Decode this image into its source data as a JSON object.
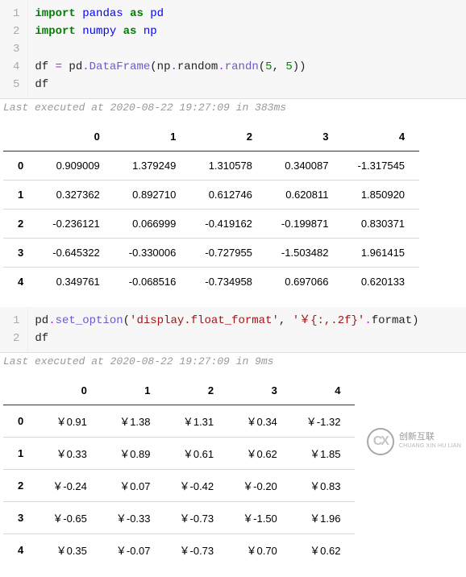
{
  "cells": [
    {
      "lines": [
        "1",
        "2",
        "3",
        "4",
        "5"
      ],
      "code_html": "<span class='kw'>import</span> <span class='pkg'>pandas</span> <span class='kw'>as</span> <span class='pkg'>pd</span>\n<span class='kw'>import</span> <span class='pkg'>numpy</span> <span class='kw'>as</span> <span class='pkg'>np</span>\n\n<span class='plain'>df </span><span class='op'>=</span><span class='plain'> pd</span><span class='op'>.</span><span class='fn'>DataFrame</span><span class='plain'>(np</span><span class='op'>.</span><span class='plain'>random</span><span class='op'>.</span><span class='fn'>randn</span><span class='plain'>(</span><span class='num'>5</span><span class='plain'>, </span><span class='num'>5</span><span class='plain'>))</span>\n<span class='plain'>df</span>",
      "status": "Last executed at 2020-08-22 19:27:09 in 383ms",
      "table": {
        "cols": [
          "0",
          "1",
          "2",
          "3",
          "4"
        ],
        "rows": [
          {
            "h": "0",
            "c": [
              "0.909009",
              "1.379249",
              "1.310578",
              "0.340087",
              "-1.317545"
            ]
          },
          {
            "h": "1",
            "c": [
              "0.327362",
              "0.892710",
              "0.612746",
              "0.620811",
              "1.850920"
            ]
          },
          {
            "h": "2",
            "c": [
              "-0.236121",
              "0.066999",
              "-0.419162",
              "-0.199871",
              "0.830371"
            ]
          },
          {
            "h": "3",
            "c": [
              "-0.645322",
              "-0.330006",
              "-0.727955",
              "-1.503482",
              "1.961415"
            ]
          },
          {
            "h": "4",
            "c": [
              "0.349761",
              "-0.068516",
              "-0.734958",
              "0.697066",
              "0.620133"
            ]
          }
        ]
      }
    },
    {
      "lines": [
        "1",
        "2"
      ],
      "code_html": "<span class='plain'>pd</span><span class='op'>.</span><span class='fn'>set_option</span><span class='plain'>(</span><span class='str'>'display.float_format'</span><span class='plain'>, </span><span class='str'>'￥{:,.2f}'</span><span class='op'>.</span><span class='plain'>format)</span>\n<span class='plain'>df</span>",
      "status": "Last executed at 2020-08-22 19:27:09 in 9ms",
      "table": {
        "cols": [
          "0",
          "1",
          "2",
          "3",
          "4"
        ],
        "rows": [
          {
            "h": "0",
            "c": [
              "￥0.91",
              "￥1.38",
              "￥1.31",
              "￥0.34",
              "￥-1.32"
            ]
          },
          {
            "h": "1",
            "c": [
              "￥0.33",
              "￥0.89",
              "￥0.61",
              "￥0.62",
              "￥1.85"
            ]
          },
          {
            "h": "2",
            "c": [
              "￥-0.24",
              "￥0.07",
              "￥-0.42",
              "￥-0.20",
              "￥0.83"
            ]
          },
          {
            "h": "3",
            "c": [
              "￥-0.65",
              "￥-0.33",
              "￥-0.73",
              "￥-1.50",
              "￥1.96"
            ]
          },
          {
            "h": "4",
            "c": [
              "￥0.35",
              "￥-0.07",
              "￥-0.73",
              "￥0.70",
              "￥0.62"
            ]
          }
        ]
      }
    }
  ],
  "watermark": {
    "top": "创新互联",
    "bottom": "CHUANG XIN HU LIAN"
  }
}
